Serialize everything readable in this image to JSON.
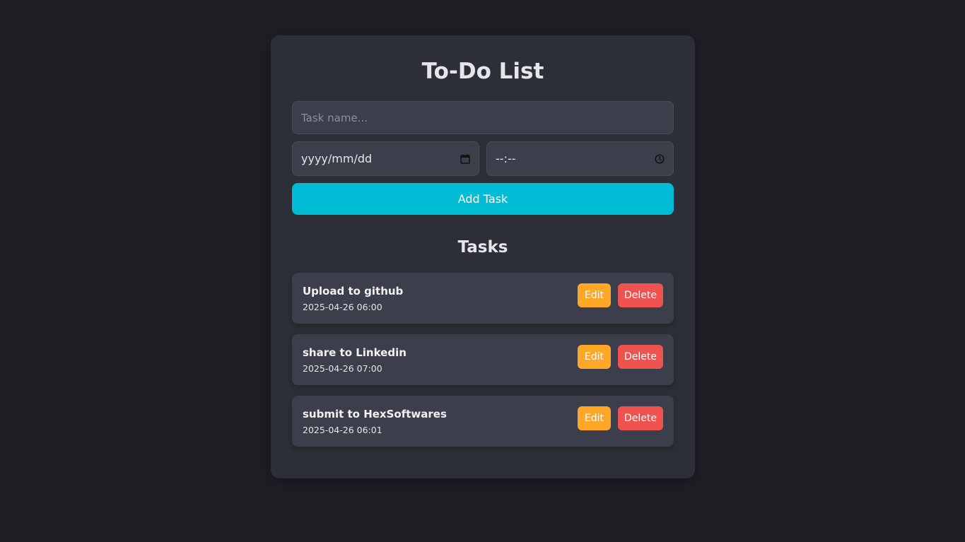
{
  "app": {
    "title": "To-Do List"
  },
  "form": {
    "task_placeholder": "Task name...",
    "task_value": "",
    "date_placeholder": "yyyy/mm/dd",
    "time_placeholder": "--:--",
    "add_label": "Add Task",
    "date_icon": "calendar-icon",
    "time_icon": "clock-icon"
  },
  "tasks_section": {
    "title": "Tasks",
    "edit_label": "Edit",
    "delete_label": "Delete",
    "items": [
      {
        "name": "Upload to github",
        "datetime": "2025-04-26 06:00"
      },
      {
        "name": "share to Linkedin",
        "datetime": "2025-04-26 07:00"
      },
      {
        "name": "submit to HexSoftwares",
        "datetime": "2025-04-26 06:01"
      }
    ]
  },
  "colors": {
    "background": "#1e1f25",
    "card": "#2d2f38",
    "input": "#3c3e4b",
    "accent": "#00bcd4",
    "edit": "#ffa726",
    "delete": "#ef5350"
  }
}
